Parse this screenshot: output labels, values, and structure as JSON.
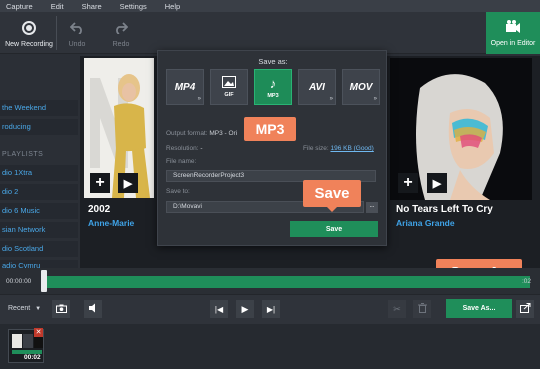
{
  "menu": [
    "Capture",
    "Edit",
    "Share",
    "Settings",
    "Help"
  ],
  "toolbar": {
    "new_recording": "New Recording",
    "undo": "Undo",
    "redo": "Redo",
    "open_in_editor": "Open in Editor"
  },
  "sidebar": {
    "items_top": [
      "the Weekend",
      "roducing"
    ],
    "playlists_heading": "PLAYLISTS",
    "items": [
      "dio 1Xtra",
      "dio 2",
      "dio 6 Music",
      "sian Network",
      "dio Scotland",
      "adio Cymru"
    ]
  },
  "tiles": [
    {
      "title": "2002",
      "artist": "Anne-Marie"
    },
    {
      "title": "No Tears Left To Cry",
      "artist": "Ariana Grande"
    }
  ],
  "dialog": {
    "title": "Save as:",
    "formats": [
      {
        "label": "MP4",
        "sub": "",
        "icon": "mp4-icon"
      },
      {
        "label": "",
        "sub": "GIF",
        "icon": "gif-icon"
      },
      {
        "label": "♪",
        "sub": "MP3",
        "icon": "music-note-icon",
        "selected": true
      },
      {
        "label": "AVI",
        "sub": "",
        "icon": "avi-icon"
      },
      {
        "label": "MOV",
        "sub": "",
        "icon": "mov-icon"
      }
    ],
    "output_format_label": "Output format:",
    "output_format_value": "MP3 - Ori",
    "resolution_label": "Resolution:",
    "resolution_value": "-",
    "file_size_label": "File size:",
    "file_size_value": "196 KB (Good)",
    "file_name_label": "File name:",
    "file_name_value": "ScreenRecorderProject3",
    "save_to_label": "Save to:",
    "save_to_value": "D:\\Movavi",
    "browse": "...",
    "save_button": "Save"
  },
  "callouts": {
    "mp3": "MP3",
    "save": "Save",
    "save_as": "Save As"
  },
  "timeline": {
    "start_time": "00:00:00",
    "end_time": ":02"
  },
  "controls": {
    "recent": "Recent",
    "save_as_button": "Save As..."
  },
  "thumbnail": {
    "duration": "00:02",
    "close": "✕"
  },
  "colors": {
    "accent_green": "#1f8e5a",
    "callout_orange": "#f0825a",
    "link_blue": "#3fa3e8"
  }
}
